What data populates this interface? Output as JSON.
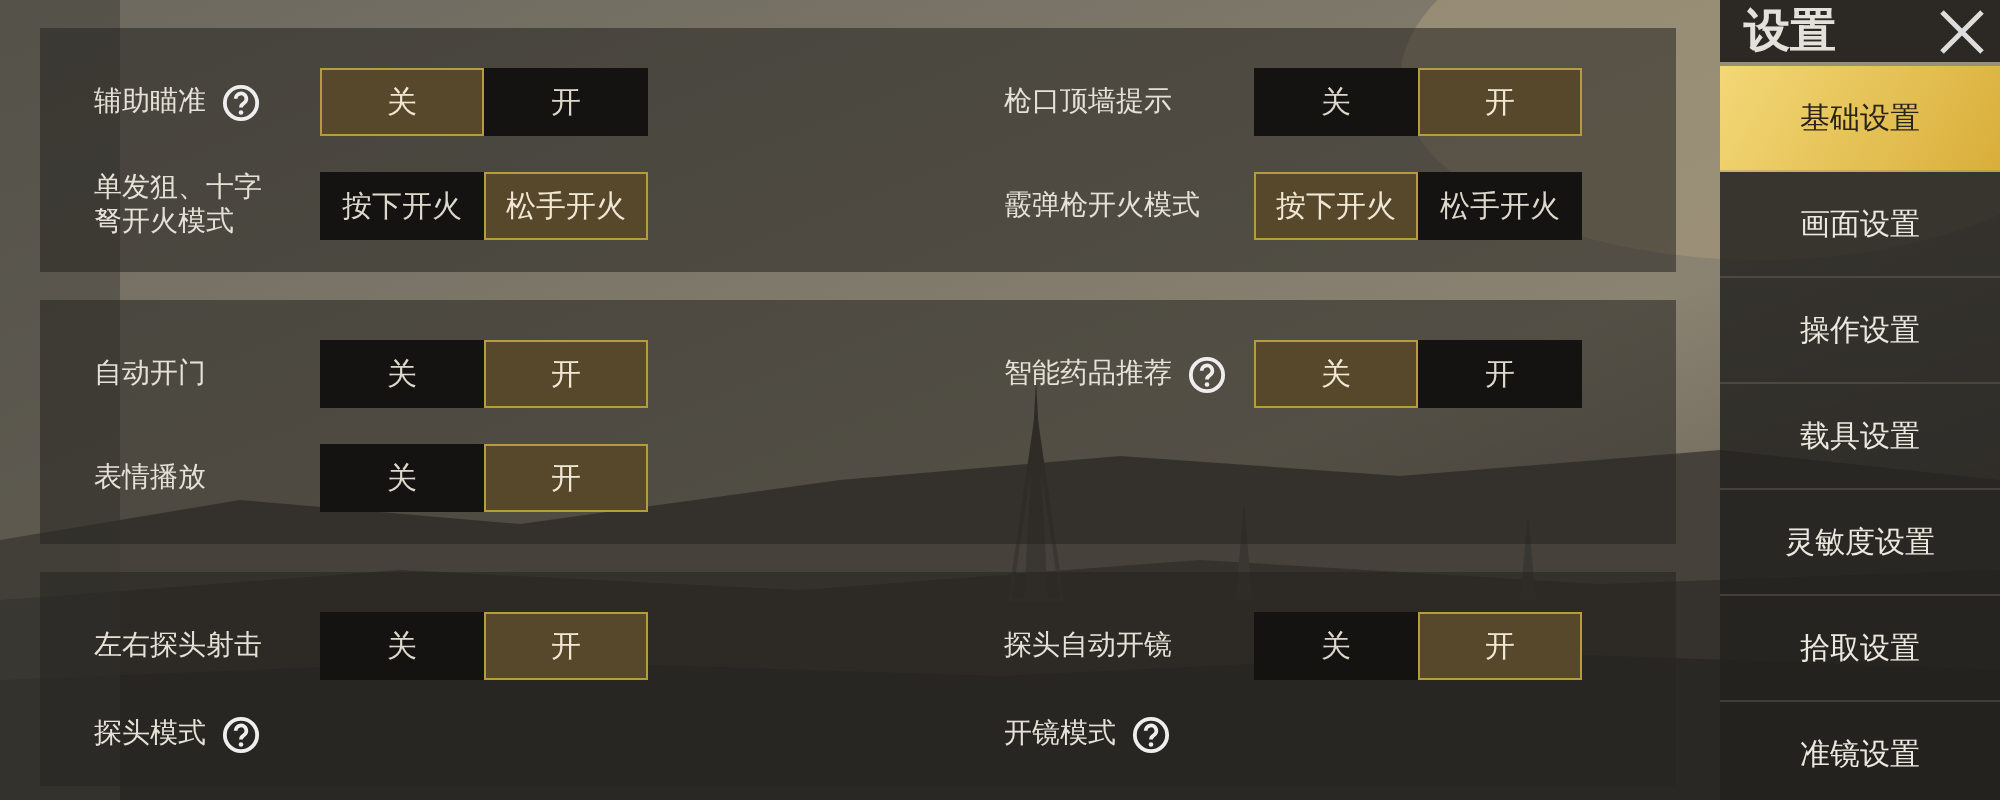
{
  "sections": [
    {
      "settings": [
        {
          "label": "辅助瞄准",
          "help": true,
          "options": [
            {
              "label": "关",
              "selected": true
            },
            {
              "label": "开",
              "selected": false
            }
          ]
        },
        {
          "label": "枪口顶墙提示",
          "help": false,
          "options": [
            {
              "label": "关",
              "selected": false
            },
            {
              "label": "开",
              "selected": true
            }
          ]
        },
        {
          "label": "单发狙、十字弩开火模式",
          "help": false,
          "options": [
            {
              "label": "按下开火",
              "selected": false
            },
            {
              "label": "松手开火",
              "selected": true
            }
          ]
        },
        {
          "label": "霰弹枪开火模式",
          "help": false,
          "options": [
            {
              "label": "按下开火",
              "selected": true
            },
            {
              "label": "松手开火",
              "selected": false
            }
          ]
        }
      ]
    },
    {
      "settings": [
        {
          "label": "自动开门",
          "help": false,
          "options": [
            {
              "label": "关",
              "selected": false
            },
            {
              "label": "开",
              "selected": true
            }
          ]
        },
        {
          "label": "智能药品推荐",
          "help": true,
          "options": [
            {
              "label": "关",
              "selected": true
            },
            {
              "label": "开",
              "selected": false
            }
          ]
        },
        {
          "label": "表情播放",
          "help": false,
          "options": [
            {
              "label": "关",
              "selected": false
            },
            {
              "label": "开",
              "selected": true
            }
          ]
        }
      ]
    },
    {
      "settings": [
        {
          "label": "左右探头射击",
          "help": false,
          "options": [
            {
              "label": "关",
              "selected": false
            },
            {
              "label": "开",
              "selected": true
            }
          ]
        },
        {
          "label": "探头自动开镜",
          "help": false,
          "options": [
            {
              "label": "关",
              "selected": false
            },
            {
              "label": "开",
              "selected": true
            }
          ]
        },
        {
          "label": "探头模式",
          "help": true
        },
        {
          "label": "开镜模式",
          "help": true
        }
      ]
    }
  ],
  "sidebar": {
    "title": "设置",
    "items": [
      {
        "label": "基础设置",
        "selected": true
      },
      {
        "label": "画面设置",
        "selected": false
      },
      {
        "label": "操作设置",
        "selected": false
      },
      {
        "label": "载具设置",
        "selected": false
      },
      {
        "label": "灵敏度设置",
        "selected": false
      },
      {
        "label": "拾取设置",
        "selected": false
      },
      {
        "label": "准镜设置",
        "selected": false
      }
    ]
  }
}
